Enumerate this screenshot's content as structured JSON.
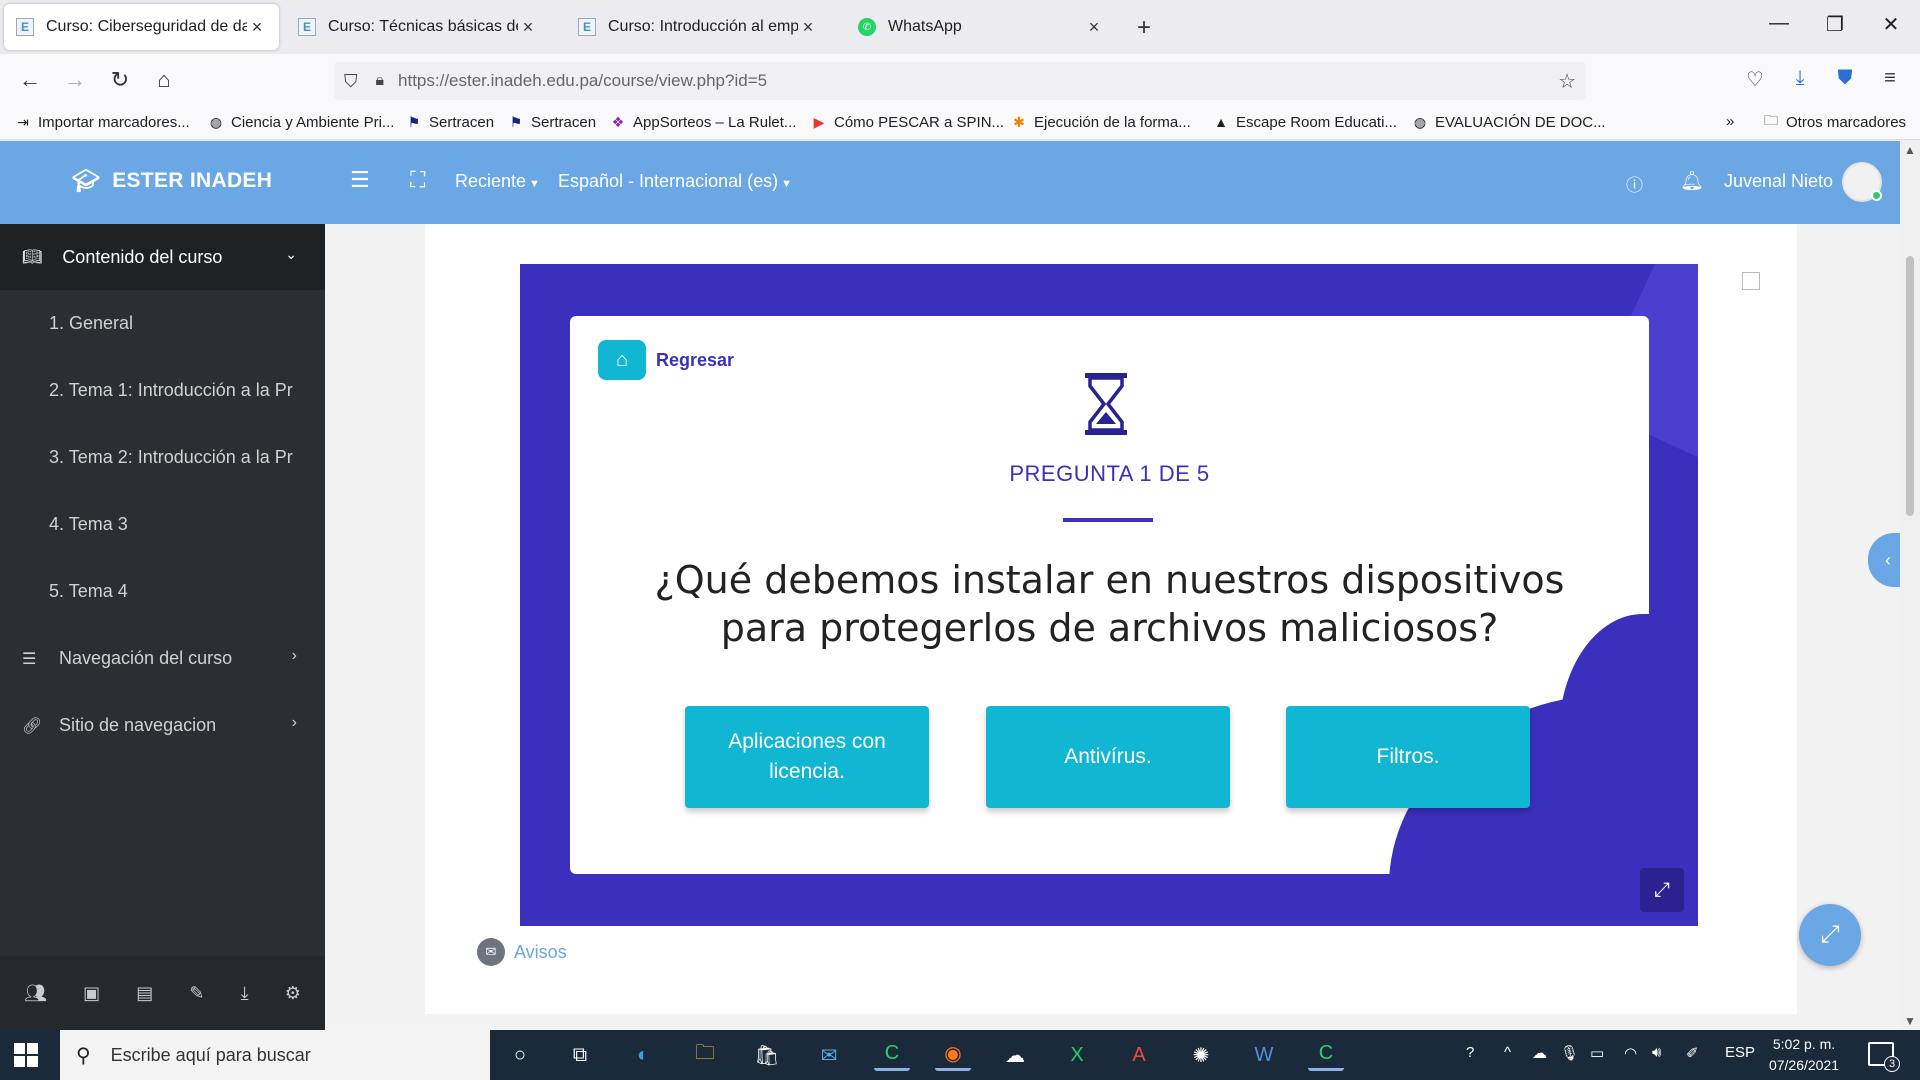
{
  "browser": {
    "tabs": [
      {
        "title": "Curso: Ciberseguridad de datos",
        "favicon": "E",
        "active": true
      },
      {
        "title": "Curso: Técnicas básicas de cocina",
        "favicon": "E",
        "active": false
      },
      {
        "title": "Curso: Introducción al emprendimiento",
        "favicon": "E",
        "active": false
      },
      {
        "title": "WhatsApp",
        "favicon": "whatsapp-icon",
        "active": false
      }
    ],
    "url": "https://ester.inadeh.edu.pa/course/view.php?id=5",
    "bookmarks": [
      "Importar marcadores...",
      "Ciencia y Ambiente Pri...",
      "Sertracen",
      "Sertracen",
      "AppSorteos – La Rulet...",
      "Cómo PESCAR a SPIN...",
      "Ejecución de la forma...",
      "Escape Room Educati...",
      "EVALUACIÓN DE DOC..."
    ],
    "other_bookmarks": "Otros marcadores"
  },
  "header": {
    "brand": "ESTER INADEH",
    "recent": "Reciente",
    "language": "Español - Internacional (es)",
    "user": "Juvenal Nieto"
  },
  "sidebar": {
    "course_content": "Contenido del curso",
    "items": [
      {
        "label": "1.  General"
      },
      {
        "label": "2.  Tema 1: Introducción a la Pr"
      },
      {
        "label": "3.  Tema 2: Introducción a la Pr"
      },
      {
        "label": "4.  Tema 3"
      },
      {
        "label": "5.  Tema 4"
      }
    ],
    "course_nav": "Navegación del curso",
    "site_nav": "Sitio de navegacion"
  },
  "quiz": {
    "back_label": "Regresar",
    "counter": "PREGUNTA 1 DE 5",
    "question": "¿Qué debemos instalar en nuestros dispositivos para protegerlos de archivos maliciosos?",
    "answers": [
      "Aplicaciones con licencia.",
      "Antivírus.",
      "Filtros."
    ]
  },
  "avisos": "Avisos",
  "taskbar": {
    "search_placeholder": "Escribe aquí para buscar",
    "lang": "ESP",
    "time": "5:02 p. m.",
    "date": "07/26/2021",
    "notifications": "3"
  },
  "colors": {
    "header_blue": "#6aa7e4",
    "slide_purple": "#3b2fbd",
    "answer_cyan": "#11b6d3",
    "sidebar_dark": "#2b2f33"
  }
}
